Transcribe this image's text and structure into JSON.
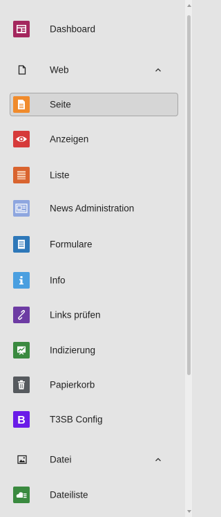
{
  "menu": {
    "dashboard": {
      "label": "Dashboard",
      "icon": "dashboard-icon",
      "color": "#a4275e"
    },
    "web": {
      "label": "Web",
      "icon": "page-outline-icon",
      "expanded": true
    },
    "seite": {
      "label": "Seite",
      "icon": "page-icon",
      "color": "#f08b2c",
      "active": true
    },
    "anzeigen": {
      "label": "Anzeigen",
      "icon": "eye-icon",
      "color": "#d63a3a"
    },
    "liste": {
      "label": "Liste",
      "icon": "list-icon",
      "color": "#d9642f"
    },
    "news": {
      "label": "News Administration",
      "icon": "news-icon",
      "color": "#8ea6df"
    },
    "formulare": {
      "label": "Formulare",
      "icon": "form-icon",
      "color": "#2e78b9"
    },
    "info": {
      "label": "Info",
      "icon": "info-icon",
      "color": "#4a9fe0"
    },
    "links": {
      "label": "Links prüfen",
      "icon": "link-icon",
      "color": "#6d3ba3"
    },
    "indizierung": {
      "label": "Indizierung",
      "icon": "chart-icon",
      "color": "#3a8a3f"
    },
    "papierkorb": {
      "label": "Papierkorb",
      "icon": "trash-icon",
      "color": "#565a5e"
    },
    "t3sb": {
      "label": "T3SB Config",
      "icon": "bootstrap-icon",
      "color": "#6a1be8"
    },
    "datei": {
      "label": "Datei",
      "icon": "image-icon",
      "expanded": true
    },
    "dateiliste": {
      "label": "Dateiliste",
      "icon": "cloud-files-icon",
      "color": "#3a8a3f"
    }
  }
}
